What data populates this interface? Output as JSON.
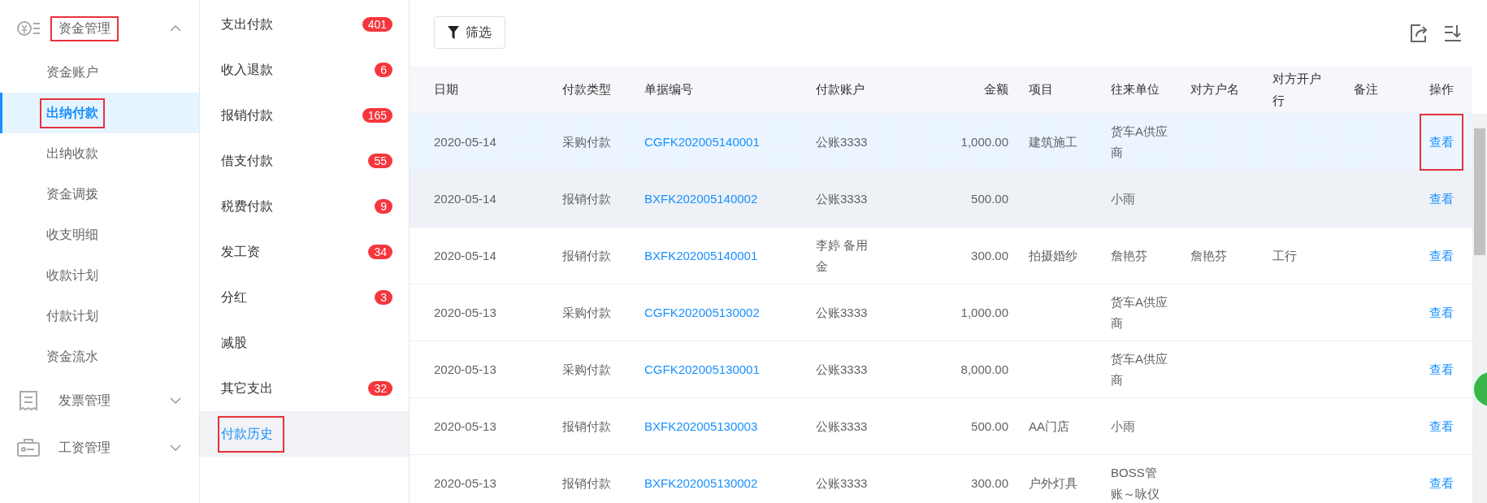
{
  "sidebar": {
    "groups": [
      {
        "label": "资金管理",
        "expanded": true,
        "annotated": true,
        "children": [
          {
            "label": "资金账户",
            "selected": false,
            "annotated": false
          },
          {
            "label": "出纳付款",
            "selected": true,
            "annotated": true
          },
          {
            "label": "出纳收款",
            "selected": false,
            "annotated": false
          },
          {
            "label": "资金调拨",
            "selected": false,
            "annotated": false
          },
          {
            "label": "收支明细",
            "selected": false,
            "annotated": false
          },
          {
            "label": "收款计划",
            "selected": false,
            "annotated": false
          },
          {
            "label": "付款计划",
            "selected": false,
            "annotated": false
          },
          {
            "label": "资金流水",
            "selected": false,
            "annotated": false
          }
        ]
      },
      {
        "label": "发票管理",
        "expanded": false,
        "annotated": false
      },
      {
        "label": "工资管理",
        "expanded": false,
        "annotated": false
      }
    ]
  },
  "submenu": {
    "items": [
      {
        "label": "支出付款",
        "badge": "401",
        "selected": false,
        "annotated": false
      },
      {
        "label": "收入退款",
        "badge": "6",
        "selected": false,
        "annotated": false
      },
      {
        "label": "报销付款",
        "badge": "165",
        "selected": false,
        "annotated": false
      },
      {
        "label": "借支付款",
        "badge": "55",
        "selected": false,
        "annotated": false
      },
      {
        "label": "税费付款",
        "badge": "9",
        "selected": false,
        "annotated": false
      },
      {
        "label": "发工资",
        "badge": "34",
        "selected": false,
        "annotated": false
      },
      {
        "label": "分红",
        "badge": "3",
        "selected": false,
        "annotated": false
      },
      {
        "label": "减股",
        "selected": false,
        "annotated": false
      },
      {
        "label": "其它支出",
        "badge": "32",
        "selected": false,
        "annotated": false
      },
      {
        "label": "付款历史",
        "selected": true,
        "annotated": true
      }
    ]
  },
  "toolbar": {
    "filter_button": "筛选"
  },
  "table": {
    "columns": [
      "日期",
      "付款类型",
      "单据编号",
      "付款账户",
      "金额",
      "项目",
      "往来单位",
      "对方户名",
      "对方开户行",
      "备注",
      "操作"
    ],
    "rows": [
      {
        "selected": true,
        "hovered": false,
        "cells": [
          "2020-05-14",
          "采购付款",
          "CGFK202005140001",
          "公账3333",
          "1,000.00",
          "建筑施工",
          "货车A供应商",
          "",
          "",
          "",
          "查看"
        ],
        "action_annotated": true
      },
      {
        "selected": false,
        "hovered": true,
        "cells": [
          "2020-05-14",
          "报销付款",
          "BXFK202005140002",
          "公账3333",
          "500.00",
          "",
          "小雨",
          "",
          "",
          "",
          "查看"
        ],
        "action_annotated": false
      },
      {
        "selected": false,
        "hovered": false,
        "cells": [
          "2020-05-14",
          "报销付款",
          "BXFK202005140001",
          "李婷 备用金",
          "300.00",
          "拍摄婚纱",
          "詹艳芬",
          "詹艳芬",
          "工行",
          "",
          "查看"
        ],
        "action_annotated": false
      },
      {
        "selected": false,
        "hovered": false,
        "cells": [
          "2020-05-13",
          "采购付款",
          "CGFK202005130002",
          "公账3333",
          "1,000.00",
          "",
          "货车A供应商",
          "",
          "",
          "",
          "查看"
        ],
        "action_annotated": false
      },
      {
        "selected": false,
        "hovered": false,
        "cells": [
          "2020-05-13",
          "采购付款",
          "CGFK202005130001",
          "公账3333",
          "8,000.00",
          "",
          "货车A供应商",
          "",
          "",
          "",
          "查看"
        ],
        "action_annotated": false
      },
      {
        "selected": false,
        "hovered": false,
        "cells": [
          "2020-05-13",
          "报销付款",
          "BXFK202005130003",
          "公账3333",
          "500.00",
          "AA门店",
          "小雨",
          "",
          "",
          "",
          "查看"
        ],
        "action_annotated": false
      },
      {
        "selected": false,
        "hovered": false,
        "cells": [
          "2020-05-13",
          "报销付款",
          "BXFK202005130002",
          "公账3333",
          "300.00",
          "户外灯具",
          "BOSS管账～咏仪",
          "",
          "",
          "",
          "查看"
        ],
        "action_annotated": false
      }
    ]
  }
}
